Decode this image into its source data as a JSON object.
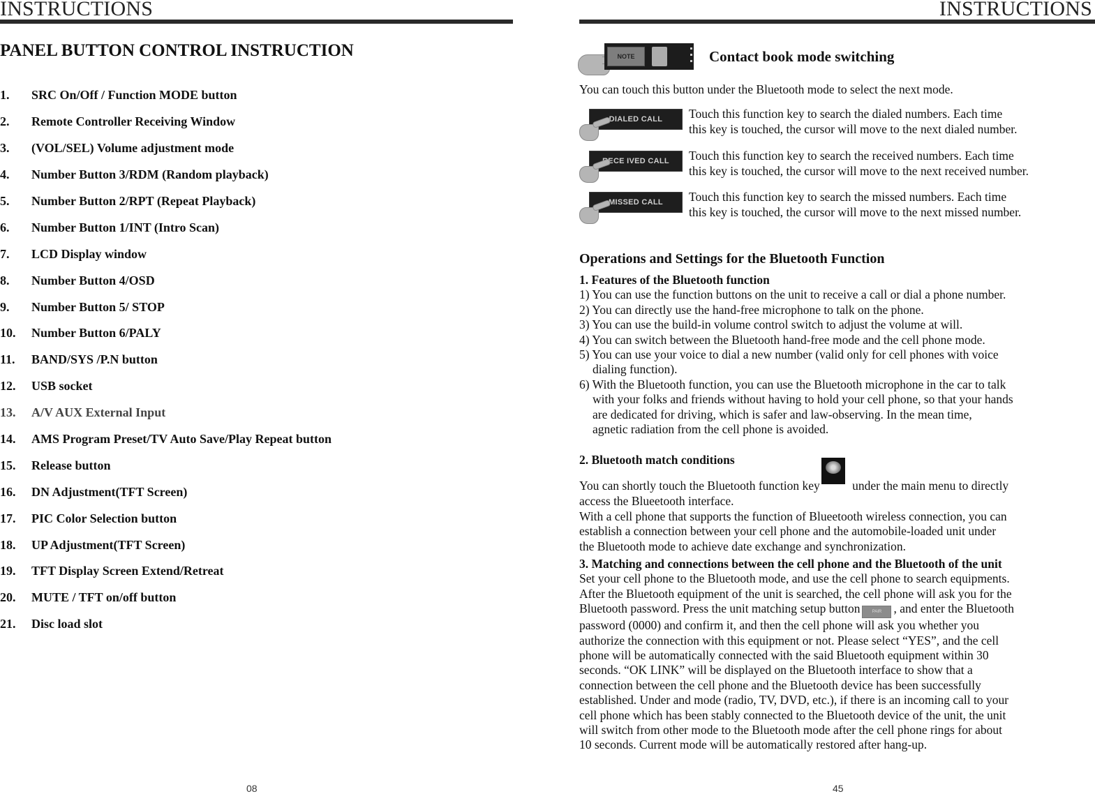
{
  "left_page": {
    "running_head": "INSTRUCTIONS",
    "section_title": "PANEL BUTTON CONTROL INSTRUCTION",
    "items": [
      {
        "num": "1.",
        "label": "SRC On/Off / Function MODE button"
      },
      {
        "num": "2.",
        "label": "Remote Controller Receiving Window"
      },
      {
        "num": "3.",
        "label": "(VOL/SEL) Volume adjustment mode"
      },
      {
        "num": "4.",
        "label": "Number Button 3/RDM (Random playback)"
      },
      {
        "num": "5.",
        "label": "Number Button 2/RPT (Repeat Playback)"
      },
      {
        "num": "6.",
        "label": "Number Button 1/INT (Intro Scan)"
      },
      {
        "num": "7.",
        "label": "LCD Display window"
      },
      {
        "num": "8.",
        "label": "Number Button 4/OSD"
      },
      {
        "num": "9.",
        "label": "Number Button 5/ STOP"
      },
      {
        "num": "10.",
        "label": "Number Button 6/PALY"
      },
      {
        "num": "11.",
        "label": "BAND/SYS /P.N button"
      },
      {
        "num": "12.",
        "label": "USB socket"
      },
      {
        "num": "13.",
        "label": "A/V AUX External Input"
      },
      {
        "num": "14.",
        "label": "AMS Program Preset/TV Auto Save/Play Repeat button"
      },
      {
        "num": "15.",
        "label": "Release button"
      },
      {
        "num": "16.",
        "label": "DN Adjustment(TFT Screen)"
      },
      {
        "num": "17.",
        "label": "PIC Color Selection button"
      },
      {
        "num": "18.",
        "label": "UP Adjustment(TFT Screen)"
      },
      {
        "num": "19.",
        "label": "TFT Display Screen Extend/Retreat"
      },
      {
        "num": "20.",
        "label": "MUTE / TFT on/off button"
      },
      {
        "num": "21.",
        "label": "Disc load slot"
      }
    ],
    "page_number": "08"
  },
  "right_page": {
    "running_head": "INSTRUCTIONS",
    "note_button": {
      "key_label": "NOTE",
      "title": "Contact book mode switching"
    },
    "intro": "You can touch this button under the Bluetooth mode to select the next mode.",
    "function_keys": [
      {
        "key_label": "DIALED CALL",
        "line1": "Touch this function key to search the dialed numbers. Each time",
        "line2": "this key is touched, the cursor will move to the next dialed number."
      },
      {
        "key_label": "RECE IVED CALL",
        "line1": "Touch this function key to search the received numbers. Each time",
        "line2": "this key is touched, the cursor will move to the next received number."
      },
      {
        "key_label": "MISSED CALL",
        "line1": "Touch this function key to search the missed numbers. Each time",
        "line2": "this key is touched, the cursor will move to the next missed number."
      }
    ],
    "ops_title": "Operations and Settings for the Bluetooth Function",
    "features": {
      "heading": "1. Features of the Bluetooth function",
      "lines": [
        "1) You can use the function buttons on the unit to receive a call or dial a phone number.",
        "2) You can directly use the hand-free microphone to talk on the phone.",
        "3) You can use the build-in volume control switch to adjust the volume at will.",
        "4) You can switch between the Bluetooth hand-free mode and the cell phone mode.",
        "5) You can use your voice to dial a new number (valid only for cell phones with voice"
      ],
      "line5_cont": "dialing function).",
      "line6": "6) With the Bluetooth function, you can use the Bluetooth microphone in the car to talk",
      "line6_cont": [
        "with your folks and friends without having to hold your cell phone, so that your hands",
        "are dedicated for driving, which is safer and law-observing. In the mean time,",
        "agnetic radiation from the cell phone is avoided."
      ]
    },
    "match": {
      "heading": "2. Bluetooth match conditions",
      "line1_before": "You can shortly touch the Bluetooth function key",
      "line1_after": " under the main menu to directly",
      "lines": [
        "access the Blueetooth interface.",
        "With a cell phone that supports the function of Blueetooth wireless connection, you can",
        "establish a connection between your cell phone and the automobile-loaded unit under",
        "the Bluetooth mode to achieve date exchange and synchronization."
      ]
    },
    "matching": {
      "heading": "3. Matching and connections between the cell phone and the Bluetooth of the unit",
      "lines_a": [
        "Set your cell phone to the Bluetooth mode, and use the cell phone to search equipments.",
        "After the Bluetooth equipment of the unit is searched, the cell phone will ask you for the"
      ],
      "pair_before": "Bluetooth password. Press the unit matching setup button",
      "pair_label": "PAIR",
      "pair_after": ", and enter the Bluetooth",
      "lines_b": [
        "password (0000) and confirm it, and then the cell phone will ask you whether you",
        "authorize the connection with this equipment or not. Please select “YES”, and the cell",
        "phone will be automatically connected with the said Bluetooth equipment within 30",
        "seconds. “OK LINK” will be displayed on the Bluetooth interface to show that a",
        "connection between the cell phone and the Bluetooth device has been successfully",
        "established. Under and mode (radio, TV, DVD, etc.), if there is an incoming call to your",
        "cell phone which has been stably connected to the Bluetooth device of the unit, the unit",
        "will switch from other mode to the Bluetooth mode after the cell phone rings for about",
        "10 seconds. Current mode will be automatically restored after hang-up."
      ]
    },
    "page_number": "45"
  }
}
